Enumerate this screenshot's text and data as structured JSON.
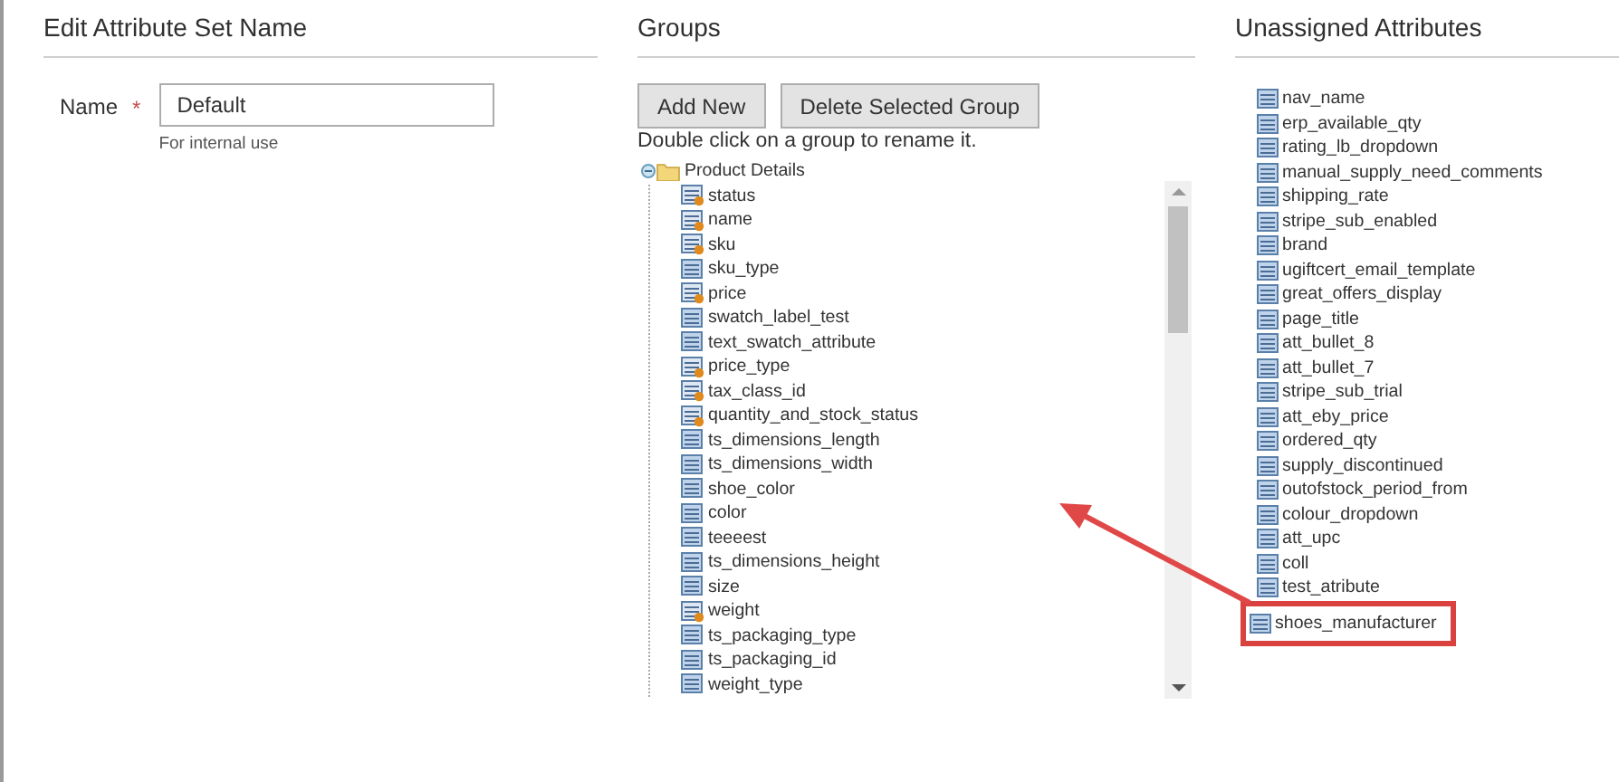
{
  "set_name_section": {
    "title": "Edit Attribute Set Name",
    "field": {
      "label": "Name",
      "required_mark": "*",
      "value": "Default",
      "note": "For internal use"
    }
  },
  "groups_section": {
    "title": "Groups",
    "buttons": [
      "Add New",
      "Delete Selected Group"
    ],
    "hint": "Double click on a group to rename it.",
    "tree": {
      "label": "Product Details",
      "expanded": true,
      "children": [
        {
          "label": "status",
          "kind": "system"
        },
        {
          "label": "name",
          "kind": "system"
        },
        {
          "label": "sku",
          "kind": "system"
        },
        {
          "label": "sku_type",
          "kind": "custom"
        },
        {
          "label": "price",
          "kind": "system"
        },
        {
          "label": "swatch_label_test",
          "kind": "custom"
        },
        {
          "label": "text_swatch_attribute",
          "kind": "custom"
        },
        {
          "label": "price_type",
          "kind": "system"
        },
        {
          "label": "tax_class_id",
          "kind": "system"
        },
        {
          "label": "quantity_and_stock_status",
          "kind": "system"
        },
        {
          "label": "ts_dimensions_length",
          "kind": "custom"
        },
        {
          "label": "ts_dimensions_width",
          "kind": "custom"
        },
        {
          "label": "shoe_color",
          "kind": "custom"
        },
        {
          "label": "color",
          "kind": "custom"
        },
        {
          "label": "teeeest",
          "kind": "custom"
        },
        {
          "label": "ts_dimensions_height",
          "kind": "custom"
        },
        {
          "label": "size",
          "kind": "custom"
        },
        {
          "label": "weight",
          "kind": "system"
        },
        {
          "label": "ts_packaging_type",
          "kind": "custom"
        },
        {
          "label": "ts_packaging_id",
          "kind": "custom"
        },
        {
          "label": "weight_type",
          "kind": "custom"
        }
      ]
    }
  },
  "unassigned_section": {
    "title": "Unassigned Attributes",
    "items": [
      {
        "label": "nav_name",
        "highlighted": false
      },
      {
        "label": "erp_available_qty",
        "highlighted": false
      },
      {
        "label": "rating_lb_dropdown",
        "highlighted": false
      },
      {
        "label": "manual_supply_need_comments",
        "highlighted": false
      },
      {
        "label": "shipping_rate",
        "highlighted": false
      },
      {
        "label": "stripe_sub_enabled",
        "highlighted": false
      },
      {
        "label": "brand",
        "highlighted": false
      },
      {
        "label": "ugiftcert_email_template",
        "highlighted": false
      },
      {
        "label": "great_offers_display",
        "highlighted": false
      },
      {
        "label": "page_title",
        "highlighted": false
      },
      {
        "label": "att_bullet_8",
        "highlighted": false
      },
      {
        "label": "att_bullet_7",
        "highlighted": false
      },
      {
        "label": "stripe_sub_trial",
        "highlighted": false
      },
      {
        "label": "att_eby_price",
        "highlighted": false
      },
      {
        "label": "ordered_qty",
        "highlighted": false
      },
      {
        "label": "supply_discontinued",
        "highlighted": false
      },
      {
        "label": "outofstock_period_from",
        "highlighted": false
      },
      {
        "label": "colour_dropdown",
        "highlighted": false
      },
      {
        "label": "att_upc",
        "highlighted": false
      },
      {
        "label": "coll",
        "highlighted": false
      },
      {
        "label": "test_atribute",
        "highlighted": false
      },
      {
        "label": "shoes_manufacturer",
        "highlighted": true
      }
    ]
  }
}
